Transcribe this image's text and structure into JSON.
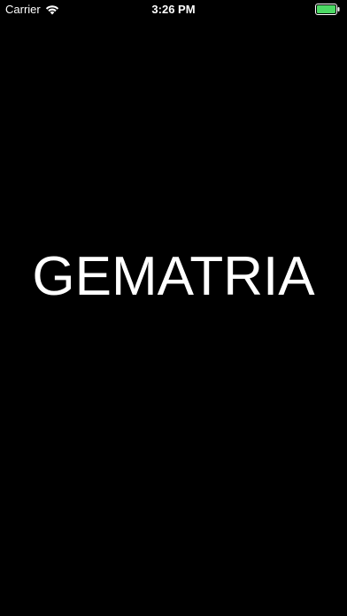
{
  "status_bar": {
    "carrier": "Carrier",
    "time": "3:26 PM",
    "wifi_icon": "wifi-icon",
    "battery_icon": "battery-icon",
    "battery_color": "#4cd964",
    "battery_level": 1.0
  },
  "splash": {
    "title": "GEMATRIA",
    "background_color": "#000000",
    "text_color": "#ffffff"
  }
}
